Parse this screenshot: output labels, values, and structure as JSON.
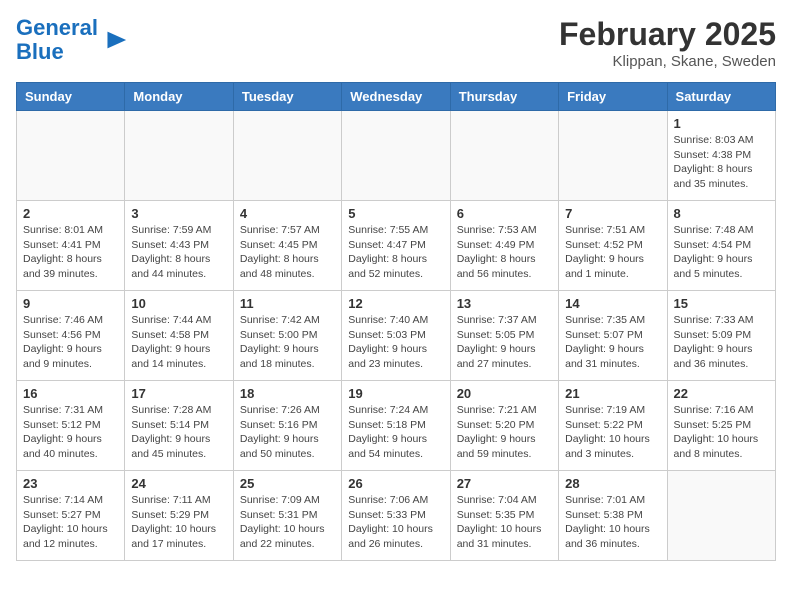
{
  "header": {
    "logo_general": "General",
    "logo_blue": "Blue",
    "month_title": "February 2025",
    "location": "Klippan, Skane, Sweden"
  },
  "days_of_week": [
    "Sunday",
    "Monday",
    "Tuesday",
    "Wednesday",
    "Thursday",
    "Friday",
    "Saturday"
  ],
  "weeks": [
    [
      {
        "day": "",
        "info": ""
      },
      {
        "day": "",
        "info": ""
      },
      {
        "day": "",
        "info": ""
      },
      {
        "day": "",
        "info": ""
      },
      {
        "day": "",
        "info": ""
      },
      {
        "day": "",
        "info": ""
      },
      {
        "day": "1",
        "info": "Sunrise: 8:03 AM\nSunset: 4:38 PM\nDaylight: 8 hours and 35 minutes."
      }
    ],
    [
      {
        "day": "2",
        "info": "Sunrise: 8:01 AM\nSunset: 4:41 PM\nDaylight: 8 hours and 39 minutes."
      },
      {
        "day": "3",
        "info": "Sunrise: 7:59 AM\nSunset: 4:43 PM\nDaylight: 8 hours and 44 minutes."
      },
      {
        "day": "4",
        "info": "Sunrise: 7:57 AM\nSunset: 4:45 PM\nDaylight: 8 hours and 48 minutes."
      },
      {
        "day": "5",
        "info": "Sunrise: 7:55 AM\nSunset: 4:47 PM\nDaylight: 8 hours and 52 minutes."
      },
      {
        "day": "6",
        "info": "Sunrise: 7:53 AM\nSunset: 4:49 PM\nDaylight: 8 hours and 56 minutes."
      },
      {
        "day": "7",
        "info": "Sunrise: 7:51 AM\nSunset: 4:52 PM\nDaylight: 9 hours and 1 minute."
      },
      {
        "day": "8",
        "info": "Sunrise: 7:48 AM\nSunset: 4:54 PM\nDaylight: 9 hours and 5 minutes."
      }
    ],
    [
      {
        "day": "9",
        "info": "Sunrise: 7:46 AM\nSunset: 4:56 PM\nDaylight: 9 hours and 9 minutes."
      },
      {
        "day": "10",
        "info": "Sunrise: 7:44 AM\nSunset: 4:58 PM\nDaylight: 9 hours and 14 minutes."
      },
      {
        "day": "11",
        "info": "Sunrise: 7:42 AM\nSunset: 5:00 PM\nDaylight: 9 hours and 18 minutes."
      },
      {
        "day": "12",
        "info": "Sunrise: 7:40 AM\nSunset: 5:03 PM\nDaylight: 9 hours and 23 minutes."
      },
      {
        "day": "13",
        "info": "Sunrise: 7:37 AM\nSunset: 5:05 PM\nDaylight: 9 hours and 27 minutes."
      },
      {
        "day": "14",
        "info": "Sunrise: 7:35 AM\nSunset: 5:07 PM\nDaylight: 9 hours and 31 minutes."
      },
      {
        "day": "15",
        "info": "Sunrise: 7:33 AM\nSunset: 5:09 PM\nDaylight: 9 hours and 36 minutes."
      }
    ],
    [
      {
        "day": "16",
        "info": "Sunrise: 7:31 AM\nSunset: 5:12 PM\nDaylight: 9 hours and 40 minutes."
      },
      {
        "day": "17",
        "info": "Sunrise: 7:28 AM\nSunset: 5:14 PM\nDaylight: 9 hours and 45 minutes."
      },
      {
        "day": "18",
        "info": "Sunrise: 7:26 AM\nSunset: 5:16 PM\nDaylight: 9 hours and 50 minutes."
      },
      {
        "day": "19",
        "info": "Sunrise: 7:24 AM\nSunset: 5:18 PM\nDaylight: 9 hours and 54 minutes."
      },
      {
        "day": "20",
        "info": "Sunrise: 7:21 AM\nSunset: 5:20 PM\nDaylight: 9 hours and 59 minutes."
      },
      {
        "day": "21",
        "info": "Sunrise: 7:19 AM\nSunset: 5:22 PM\nDaylight: 10 hours and 3 minutes."
      },
      {
        "day": "22",
        "info": "Sunrise: 7:16 AM\nSunset: 5:25 PM\nDaylight: 10 hours and 8 minutes."
      }
    ],
    [
      {
        "day": "23",
        "info": "Sunrise: 7:14 AM\nSunset: 5:27 PM\nDaylight: 10 hours and 12 minutes."
      },
      {
        "day": "24",
        "info": "Sunrise: 7:11 AM\nSunset: 5:29 PM\nDaylight: 10 hours and 17 minutes."
      },
      {
        "day": "25",
        "info": "Sunrise: 7:09 AM\nSunset: 5:31 PM\nDaylight: 10 hours and 22 minutes."
      },
      {
        "day": "26",
        "info": "Sunrise: 7:06 AM\nSunset: 5:33 PM\nDaylight: 10 hours and 26 minutes."
      },
      {
        "day": "27",
        "info": "Sunrise: 7:04 AM\nSunset: 5:35 PM\nDaylight: 10 hours and 31 minutes."
      },
      {
        "day": "28",
        "info": "Sunrise: 7:01 AM\nSunset: 5:38 PM\nDaylight: 10 hours and 36 minutes."
      },
      {
        "day": "",
        "info": ""
      }
    ]
  ]
}
